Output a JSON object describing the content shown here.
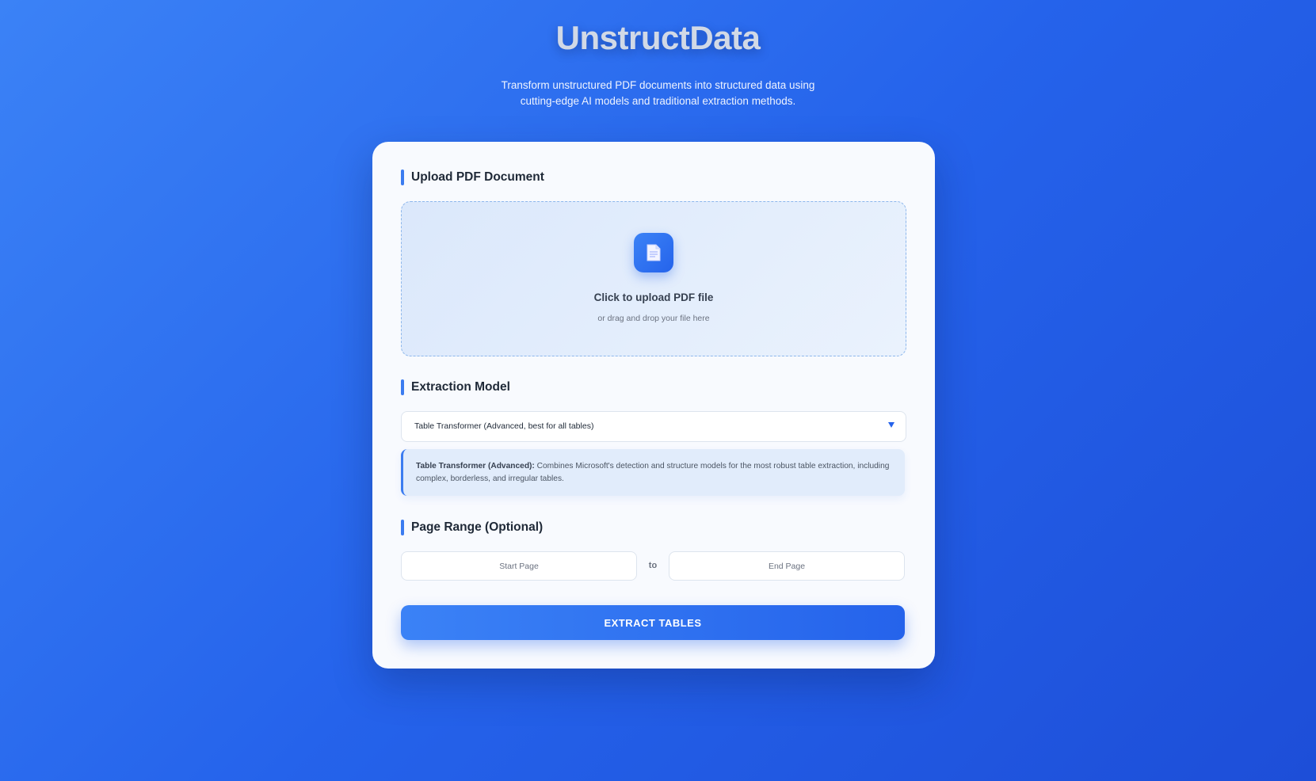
{
  "header": {
    "title": "UnstructData",
    "subtitle": "Transform unstructured PDF documents into structured data using cutting-edge AI models and traditional extraction methods."
  },
  "upload": {
    "section_title": "Upload PDF Document",
    "icon": "document-icon",
    "title": "Click to upload PDF file",
    "hint": "or drag and drop your file here"
  },
  "model": {
    "section_title": "Extraction Model",
    "selected": "Table Transformer (Advanced, best for all tables)",
    "info_name": "Table Transformer (Advanced):",
    "info_text": " Combines Microsoft's detection and structure models for the most robust table extraction, including complex, borderless, and irregular tables."
  },
  "page_range": {
    "section_title": "Page Range (Optional)",
    "start_placeholder": "Start Page",
    "separator": "to",
    "end_placeholder": "End Page"
  },
  "actions": {
    "extract_label": "EXTRACT TABLES"
  },
  "colors": {
    "accent": "#2563eb",
    "background_start": "#3b82f6",
    "background_end": "#1d4ed8",
    "card": "#f8fafe"
  }
}
